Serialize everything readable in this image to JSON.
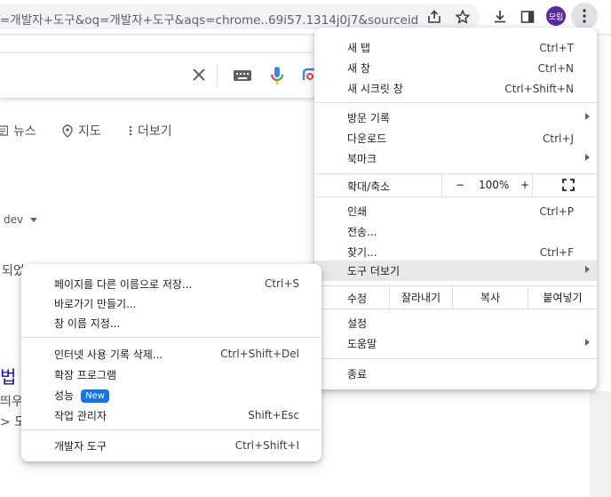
{
  "browser": {
    "url": "=개발자+도구&oq=개발자+도구&aqs=chrome..69i57.1314j0j7&sourceid...",
    "avatar_text": "모립",
    "accent": "#1a73e8"
  },
  "page": {
    "tabs": [
      {
        "label": "뉴스",
        "icon": "news-icon"
      },
      {
        "label": "지도",
        "icon": "map-pin-icon"
      },
      {
        "label": "더보기",
        "icon": "more-vert-icon"
      }
    ],
    "dev_filter": "dev",
    "snippet1": "되었",
    "link_fragment": "법",
    "snippet2": "띄우",
    "snippet3": "> 도"
  },
  "menu": {
    "new_tab": {
      "label": "새 탭",
      "shortcut": "Ctrl+T"
    },
    "new_window": {
      "label": "새 창",
      "shortcut": "Ctrl+N"
    },
    "new_incognito": {
      "label": "새 시크릿 창",
      "shortcut": "Ctrl+Shift+N"
    },
    "history": {
      "label": "방문 기록"
    },
    "downloads": {
      "label": "다운로드",
      "shortcut": "Ctrl+J"
    },
    "bookmarks": {
      "label": "북마크"
    },
    "zoom": {
      "label": "확대/축소",
      "minus": "−",
      "value": "100%",
      "plus": "+"
    },
    "print": {
      "label": "인쇄",
      "shortcut": "Ctrl+P"
    },
    "cast": {
      "label": "전송..."
    },
    "find": {
      "label": "찾기...",
      "shortcut": "Ctrl+F"
    },
    "more_tools": {
      "label": "도구 더보기"
    },
    "edit": {
      "label": "수정",
      "cut": "잘라내기",
      "copy": "복사",
      "paste": "붙여넣기"
    },
    "settings": {
      "label": "설정"
    },
    "help": {
      "label": "도움말"
    },
    "exit": {
      "label": "종료"
    }
  },
  "submenu": {
    "save_page": {
      "label": "페이지를 다른 이름으로 저장...",
      "shortcut": "Ctrl+S"
    },
    "create_shortcut": {
      "label": "바로가기 만들기..."
    },
    "name_window": {
      "label": "창 이름 지정..."
    },
    "clear_data": {
      "label": "인터넷 사용 기록 삭제...",
      "shortcut": "Ctrl+Shift+Del"
    },
    "extensions": {
      "label": "확장 프로그램"
    },
    "performance": {
      "label": "성능",
      "badge": "New"
    },
    "task_manager": {
      "label": "작업 관리자",
      "shortcut": "Shift+Esc"
    },
    "dev_tools": {
      "label": "개발자 도구",
      "shortcut": "Ctrl+Shift+I"
    }
  }
}
